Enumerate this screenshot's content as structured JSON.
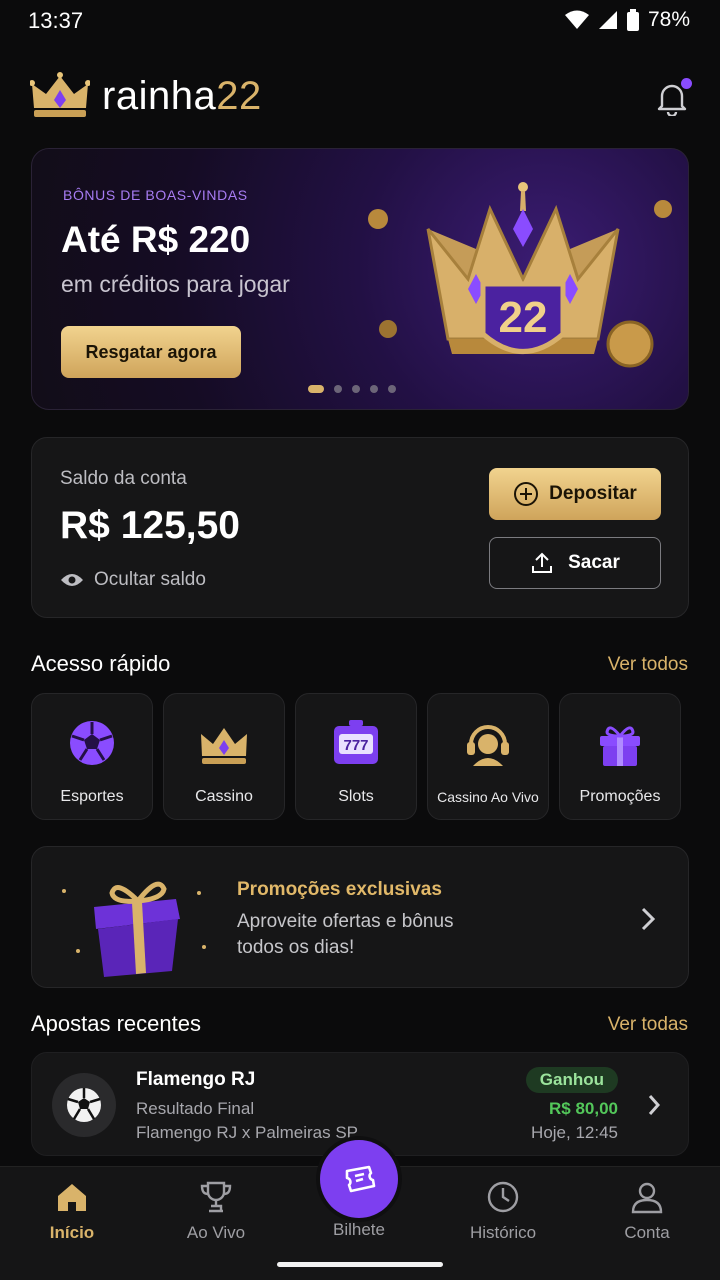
{
  "status_bar": {
    "time": "13:37",
    "battery": "78%"
  },
  "header": {
    "brand_main": "rainha",
    "brand_accent": "22"
  },
  "banner": {
    "eyebrow": "BÔNUS DE BOAS-VINDAS",
    "title": "Até R$ 220",
    "subtitle": "em créditos para jogar",
    "cta": "Resgatar agora",
    "crown_number": "22",
    "carousel_count": 4,
    "carousel_active_index": 0
  },
  "balance": {
    "label": "Saldo da conta",
    "amount": "R$ 125,50",
    "hide_label": "Ocultar saldo",
    "deposit_label": "Depositar",
    "withdraw_label": "Sacar"
  },
  "quick_access": {
    "title": "Acesso rápido",
    "link": "Ver todos",
    "items": [
      {
        "label": "Esportes",
        "icon": "soccer-ball-icon"
      },
      {
        "label": "Cassino",
        "icon": "crown-icon"
      },
      {
        "label": "Slots",
        "icon": "slot-machine-icon"
      },
      {
        "label": "Cassino Ao Vivo",
        "icon": "live-dealer-icon"
      },
      {
        "label": "Promoções",
        "icon": "gift-icon"
      }
    ]
  },
  "promo_card": {
    "title": "Promoções exclusivas",
    "text": "Aproveite ofertas e bônus todos os dias!"
  },
  "recent_bets": {
    "title": "Apostas recentes",
    "link": "Ver todas",
    "items": [
      {
        "team": "Flamengo RJ",
        "market": "Resultado Final",
        "match": "Flamengo RJ x Palmeiras SP",
        "status": "Ganhou",
        "amount": "R$ 80,00",
        "time": "Hoje, 12:45"
      }
    ]
  },
  "tab_bar": {
    "items": [
      {
        "label": "Início",
        "icon": "home-icon",
        "active": true
      },
      {
        "label": "Ao Vivo",
        "icon": "trophy-icon",
        "active": false
      },
      {
        "label": "Bilhete",
        "icon": "ticket-icon",
        "active": false
      },
      {
        "label": "Histórico",
        "icon": "clock-icon",
        "active": false
      },
      {
        "label": "Conta",
        "icon": "user-icon",
        "active": false
      }
    ]
  },
  "colors": {
    "accent_gold": "#d9b36a",
    "accent_purple": "#7d3ff0",
    "background": "#0b0b0c",
    "success": "#53c75a"
  }
}
